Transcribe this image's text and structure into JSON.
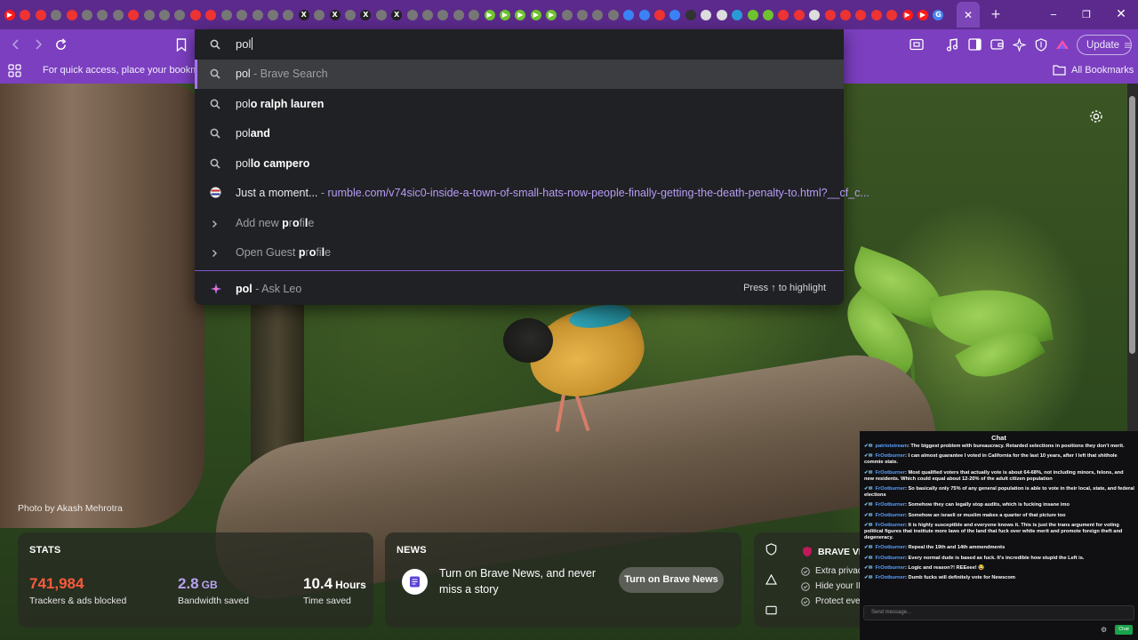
{
  "tabstrip": {
    "tab_icons": [
      {
        "name": "youtube-icon",
        "color": "#ff1a1a",
        "glyph": "▶"
      },
      {
        "name": "favicon-red",
        "color": "#e33",
        "glyph": ""
      },
      {
        "name": "favicon-red",
        "color": "#e33",
        "glyph": ""
      },
      {
        "name": "favicon-gray",
        "color": "#777",
        "glyph": ""
      },
      {
        "name": "favicon-red",
        "color": "#e33",
        "glyph": ""
      },
      {
        "name": "favicon-gray",
        "color": "#777",
        "glyph": ""
      },
      {
        "name": "favicon-gray",
        "color": "#777",
        "glyph": ""
      },
      {
        "name": "favicon-gray",
        "color": "#777",
        "glyph": ""
      },
      {
        "name": "favicon-red",
        "color": "#e33",
        "glyph": ""
      },
      {
        "name": "favicon-gray",
        "color": "#777",
        "glyph": ""
      },
      {
        "name": "favicon-gray",
        "color": "#777",
        "glyph": ""
      },
      {
        "name": "favicon-gray",
        "color": "#777",
        "glyph": ""
      },
      {
        "name": "favicon-red",
        "color": "#e33",
        "glyph": ""
      },
      {
        "name": "favicon-red",
        "color": "#e33",
        "glyph": ""
      },
      {
        "name": "favicon-gray",
        "color": "#777",
        "glyph": ""
      },
      {
        "name": "favicon-gray",
        "color": "#777",
        "glyph": ""
      },
      {
        "name": "favicon-gray",
        "color": "#777",
        "glyph": ""
      },
      {
        "name": "favicon-gray",
        "color": "#777",
        "glyph": ""
      },
      {
        "name": "favicon-gray",
        "color": "#777",
        "glyph": ""
      },
      {
        "name": "x-icon",
        "color": "#222",
        "glyph": "X"
      },
      {
        "name": "favicon-gray",
        "color": "#777",
        "glyph": ""
      },
      {
        "name": "x-icon",
        "color": "#222",
        "glyph": "X"
      },
      {
        "name": "favicon-gray",
        "color": "#777",
        "glyph": ""
      },
      {
        "name": "x-icon",
        "color": "#222",
        "glyph": "X"
      },
      {
        "name": "favicon-gray",
        "color": "#777",
        "glyph": ""
      },
      {
        "name": "x-icon",
        "color": "#222",
        "glyph": "X"
      },
      {
        "name": "favicon-gray",
        "color": "#777",
        "glyph": ""
      },
      {
        "name": "favicon-gray",
        "color": "#777",
        "glyph": ""
      },
      {
        "name": "favicon-gray",
        "color": "#777",
        "glyph": ""
      },
      {
        "name": "favicon-gray",
        "color": "#777",
        "glyph": ""
      },
      {
        "name": "favicon-gray",
        "color": "#777",
        "glyph": ""
      },
      {
        "name": "rumble-icon",
        "color": "#6ec32f",
        "glyph": "▶"
      },
      {
        "name": "rumble-icon",
        "color": "#6ec32f",
        "glyph": "▶"
      },
      {
        "name": "rumble-icon",
        "color": "#6ec32f",
        "glyph": "▶"
      },
      {
        "name": "rumble-icon",
        "color": "#6ec32f",
        "glyph": "▶"
      },
      {
        "name": "rumble-icon",
        "color": "#6ec32f",
        "glyph": "▶"
      },
      {
        "name": "favicon-gray",
        "color": "#777",
        "glyph": ""
      },
      {
        "name": "favicon-gray",
        "color": "#777",
        "glyph": ""
      },
      {
        "name": "favicon-gray",
        "color": "#777",
        "glyph": ""
      },
      {
        "name": "favicon-gray",
        "color": "#777",
        "glyph": ""
      },
      {
        "name": "favicon-blue",
        "color": "#3b82f6",
        "glyph": ""
      },
      {
        "name": "favicon-blue",
        "color": "#3b82f6",
        "glyph": ""
      },
      {
        "name": "favicon-red",
        "color": "#e33",
        "glyph": ""
      },
      {
        "name": "favicon-blue",
        "color": "#3b82f6",
        "glyph": ""
      },
      {
        "name": "favicon-dark",
        "color": "#333",
        "glyph": ""
      },
      {
        "name": "favicon-white",
        "color": "#ddd",
        "glyph": ""
      },
      {
        "name": "favicon-white",
        "color": "#ddd",
        "glyph": ""
      },
      {
        "name": "favicon-blue",
        "color": "#2a9bd8",
        "glyph": ""
      },
      {
        "name": "favicon-green",
        "color": "#6ec32f",
        "glyph": ""
      },
      {
        "name": "favicon-green",
        "color": "#6ec32f",
        "glyph": ""
      },
      {
        "name": "favicon-red",
        "color": "#e33",
        "glyph": ""
      },
      {
        "name": "favicon-red",
        "color": "#e33",
        "glyph": ""
      },
      {
        "name": "favicon-white",
        "color": "#ddd",
        "glyph": ""
      },
      {
        "name": "favicon-red",
        "color": "#e33",
        "glyph": ""
      },
      {
        "name": "favicon-red",
        "color": "#e33",
        "glyph": ""
      },
      {
        "name": "favicon-red",
        "color": "#e33",
        "glyph": ""
      },
      {
        "name": "favicon-red",
        "color": "#e33",
        "glyph": ""
      },
      {
        "name": "favicon-red",
        "color": "#e33",
        "glyph": ""
      },
      {
        "name": "youtube-icon",
        "color": "#ff1a1a",
        "glyph": "▶"
      },
      {
        "name": "youtube-icon",
        "color": "#ff1a1a",
        "glyph": "▶"
      },
      {
        "name": "google-icon",
        "color": "#4285f4",
        "glyph": "G"
      }
    ],
    "close_glyph": "✕",
    "newtab_glyph": "+",
    "minimize_glyph": "─",
    "maximize_glyph": "❐",
    "close_window_glyph": "✕"
  },
  "omnibox": {
    "query": "pol",
    "suggestions": [
      {
        "icon": "search-icon",
        "segments": [
          {
            "t": "pol",
            "c": ""
          },
          {
            "t": " - Brave Search",
            "c": "dim"
          }
        ],
        "highlighted": true
      },
      {
        "icon": "search-icon",
        "segments": [
          {
            "t": "pol",
            "c": ""
          },
          {
            "t": "o ralph lauren",
            "c": "b"
          }
        ]
      },
      {
        "icon": "search-icon",
        "segments": [
          {
            "t": "pol",
            "c": ""
          },
          {
            "t": "and",
            "c": "b"
          }
        ]
      },
      {
        "icon": "search-icon",
        "segments": [
          {
            "t": "pol",
            "c": ""
          },
          {
            "t": "lo campero",
            "c": "b"
          }
        ]
      },
      {
        "icon": "site-favicon",
        "segments": [
          {
            "t": "Just a moment...",
            "c": ""
          },
          {
            "t": " - ",
            "c": "dim"
          },
          {
            "t": "rumble.com/v74sic0-inside-a-town-of-small-hats-now-people-finally-getting-the-death-penalty-to.html?__cf_c...",
            "c": "url"
          }
        ]
      },
      {
        "icon": "chevron-right-icon",
        "segments": [
          {
            "t": "Add new ",
            "c": "dim"
          },
          {
            "t": "p",
            "c": "b"
          },
          {
            "t": "r",
            "c": "dim"
          },
          {
            "t": "o",
            "c": "b"
          },
          {
            "t": "fi",
            "c": "dim"
          },
          {
            "t": "l",
            "c": "b"
          },
          {
            "t": "e",
            "c": "dim"
          }
        ]
      },
      {
        "icon": "chevron-right-icon",
        "segments": [
          {
            "t": "Open Guest ",
            "c": "dim"
          },
          {
            "t": "p",
            "c": "b"
          },
          {
            "t": "r",
            "c": "dim"
          },
          {
            "t": "o",
            "c": "b"
          },
          {
            "t": "fi",
            "c": "dim"
          },
          {
            "t": "l",
            "c": "b"
          },
          {
            "t": "e",
            "c": "dim"
          }
        ]
      }
    ],
    "leo": {
      "query": "pol",
      "label": " - Ask Leo",
      "hint": "Press ↑ to highlight"
    }
  },
  "toolbar": {
    "update_label": "Update"
  },
  "bookmarks": {
    "hint": "For quick access, place your bookmark",
    "all_label": "All Bookmarks"
  },
  "ntp": {
    "photo_credit": "Photo by Akash Mehrotra",
    "stats": {
      "title": "STATS",
      "trackers_value": "741,984",
      "trackers_label": "Trackers & ads blocked",
      "bandwidth_value": "2.8",
      "bandwidth_unit": "GB",
      "bandwidth_label": "Bandwidth saved",
      "time_value": "10.4",
      "time_unit": "Hours",
      "time_label": "Time saved"
    },
    "news": {
      "title": "NEWS",
      "text": "Turn on Brave News, and never miss a story",
      "button": "Turn on Brave News"
    },
    "vpn": {
      "title": "BRAVE VP",
      "items": [
        "Extra privacy",
        "Hide your IP",
        "Protect ever"
      ]
    }
  },
  "chat": {
    "title": "Chat",
    "messages": [
      {
        "user": "patriotstream",
        "text": "The biggest problem with bureaucracy. Retarded selections in positions they don't merit."
      },
      {
        "user": "FrOotburner",
        "text": "I can almost guarantee I voted in California for the last 10 years, after I left that shithole commie state."
      },
      {
        "user": "FrOotburner",
        "text": "Most qualified voters that actually vote is about 64-68%, not including minors, felons, and new residents. Which could equal about 12-20% of the adult citizen population"
      },
      {
        "user": "FrOotburner",
        "text": "So basically only 75% of any general population is able to vote in their local, state, and federal elections"
      },
      {
        "user": "FrOotburner",
        "text": "Somehow they can legally stop audits, which is fucking insane imo"
      },
      {
        "user": "FrOotburner",
        "text": "Somehow an israeli or muslim makes a quarter of that picture too"
      },
      {
        "user": "FrOotburner",
        "text": "It is highly susceptible and everyone knows it. This is just the trans argument for voting political figures that institute more laws of the land that fuck over white merit and promote foreign theft and degeneracy."
      },
      {
        "user": "FrOotburner",
        "text": "Repeal the 19th and 14th ammendments"
      },
      {
        "user": "FrOotburner",
        "text": "Every normal dude is based as fuck. It's incredible how stupid the Left is."
      },
      {
        "user": "FrOotburner",
        "text": "Logic and reason?! REEeee! 😂"
      },
      {
        "user": "FrOotburner",
        "text": "Dumb fucks will definitely vote for Newscom"
      }
    ],
    "input_placeholder": "Send message...",
    "send_label": "Chat"
  }
}
